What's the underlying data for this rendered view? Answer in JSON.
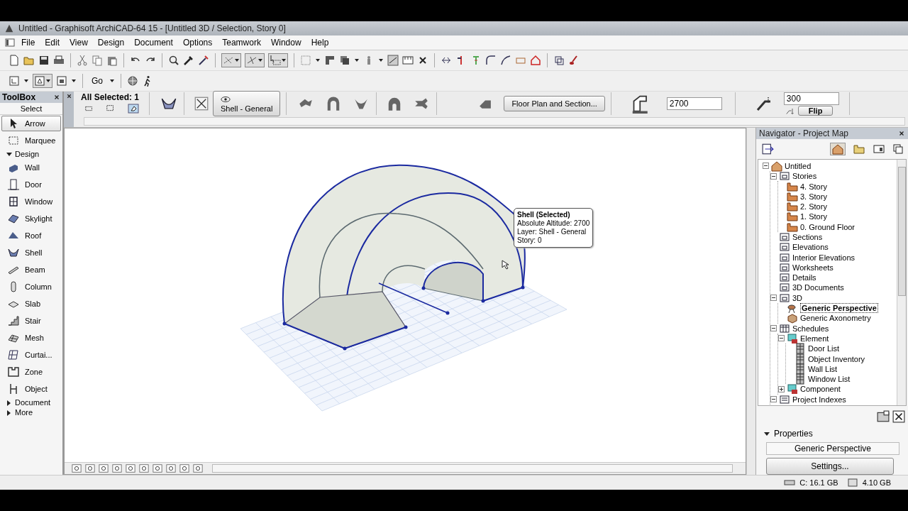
{
  "window": {
    "title": "Untitled - Graphisoft ArchiCAD-64 15 - [Untitled 3D / Selection, Story 0]"
  },
  "menu": [
    "File",
    "Edit",
    "View",
    "Design",
    "Document",
    "Options",
    "Teamwork",
    "Window",
    "Help"
  ],
  "toolbar": {
    "go_menu": "Go"
  },
  "info_box": {
    "header": "All Selected: 1",
    "layer": "Shell - General",
    "floor_plan_button": "Floor Plan and Section...",
    "altitude": "2700",
    "thickness": "300",
    "flip_button": "Flip"
  },
  "toolbox": {
    "title": "ToolBox",
    "heading": "Select",
    "items": [
      {
        "label": "Arrow",
        "kind": "tool",
        "selected": true
      },
      {
        "label": "Marquee",
        "kind": "tool",
        "selected": false
      },
      {
        "label": "Design",
        "kind": "group",
        "expanded": true
      },
      {
        "label": "Wall",
        "kind": "tool",
        "selected": false
      },
      {
        "label": "Door",
        "kind": "tool",
        "selected": false
      },
      {
        "label": "Window",
        "kind": "tool",
        "selected": false
      },
      {
        "label": "Skylight",
        "kind": "tool",
        "selected": false
      },
      {
        "label": "Roof",
        "kind": "tool",
        "selected": false
      },
      {
        "label": "Shell",
        "kind": "tool",
        "selected": false
      },
      {
        "label": "Beam",
        "kind": "tool",
        "selected": false
      },
      {
        "label": "Column",
        "kind": "tool",
        "selected": false
      },
      {
        "label": "Slab",
        "kind": "tool",
        "selected": false
      },
      {
        "label": "Stair",
        "kind": "tool",
        "selected": false
      },
      {
        "label": "Mesh",
        "kind": "tool",
        "selected": false
      },
      {
        "label": "Curtai...",
        "kind": "tool",
        "selected": false
      },
      {
        "label": "Zone",
        "kind": "tool",
        "selected": false
      },
      {
        "label": "Object",
        "kind": "tool",
        "selected": false
      },
      {
        "label": "Document",
        "kind": "group",
        "expanded": false
      },
      {
        "label": "More",
        "kind": "group",
        "expanded": false
      }
    ]
  },
  "tooltip": {
    "title": "Shell (Selected)",
    "lines": [
      "Absolute Altitude: 2700",
      "Layer: Shell - General",
      "Story: 0"
    ]
  },
  "navigator": {
    "title": "Navigator - Project Map",
    "tree": [
      {
        "label": "Untitled",
        "kind": "project",
        "expanded": true,
        "selected": false,
        "children": [
          {
            "label": "Stories",
            "kind": "folder",
            "expanded": true,
            "selected": false,
            "children": [
              {
                "label": "4. Story",
                "kind": "story",
                "selected": false
              },
              {
                "label": "3. Story",
                "kind": "story",
                "selected": false
              },
              {
                "label": "2. Story",
                "kind": "story",
                "selected": false
              },
              {
                "label": "1. Story",
                "kind": "story",
                "selected": false
              },
              {
                "label": "0. Ground Floor",
                "kind": "story",
                "selected": false
              }
            ]
          },
          {
            "label": "Sections",
            "kind": "folder",
            "selected": false
          },
          {
            "label": "Elevations",
            "kind": "folder",
            "selected": false
          },
          {
            "label": "Interior Elevations",
            "kind": "folder",
            "selected": false
          },
          {
            "label": "Worksheets",
            "kind": "folder",
            "selected": false
          },
          {
            "label": "Details",
            "kind": "folder",
            "selected": false
          },
          {
            "label": "3D Documents",
            "kind": "folder",
            "selected": false
          },
          {
            "label": "3D",
            "kind": "folder",
            "expanded": true,
            "selected": false,
            "children": [
              {
                "label": "Generic Perspective",
                "kind": "camera",
                "selected": true
              },
              {
                "label": "Generic Axonometry",
                "kind": "axon",
                "selected": false
              }
            ]
          },
          {
            "label": "Schedules",
            "kind": "schedule",
            "expanded": true,
            "selected": false,
            "children": [
              {
                "label": "Element",
                "kind": "element",
                "expanded": true,
                "selected": false,
                "children": [
                  {
                    "label": "Door List",
                    "kind": "list",
                    "selected": false
                  },
                  {
                    "label": "Object Inventory",
                    "kind": "list",
                    "selected": false
                  },
                  {
                    "label": "Wall List",
                    "kind": "list",
                    "selected": false
                  },
                  {
                    "label": "Window List",
                    "kind": "list",
                    "selected": false
                  }
                ]
              },
              {
                "label": "Component",
                "kind": "element",
                "expanded": false,
                "selected": false
              }
            ]
          },
          {
            "label": "Project Indexes",
            "kind": "index",
            "expanded": true,
            "selected": false
          }
        ]
      }
    ]
  },
  "properties": {
    "heading": "Properties",
    "expanded": true,
    "view_name": "Generic Perspective",
    "settings_button": "Settings..."
  },
  "status_bar": [
    "C: 16.1 GB",
    "4.10 GB"
  ]
}
